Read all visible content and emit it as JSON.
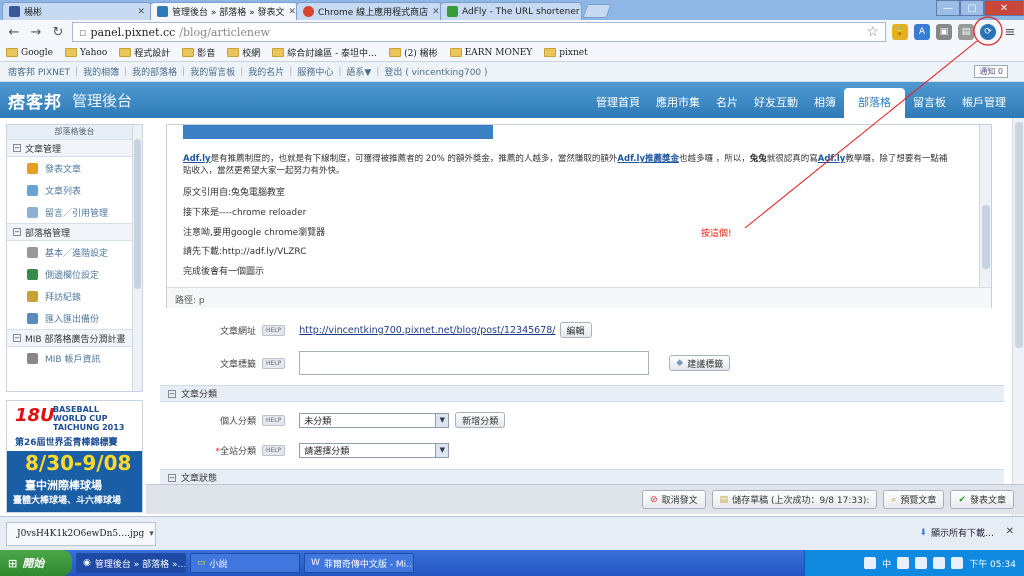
{
  "tabs": [
    {
      "label": "楊彬",
      "color": "#3b5998"
    },
    {
      "label": "管理後台 » 部落格 » 發表文",
      "color": "#2f7bb8"
    },
    {
      "label": "Chrome 線上應用程式商店",
      "color": "#d9442e"
    },
    {
      "label": "AdFly - The URL shortener",
      "color": "#3a9a3a"
    }
  ],
  "window_buttons": {
    "minimize": "—",
    "maximize": "▢",
    "close": "✕"
  },
  "toolbar": {
    "host": "panel.pixnet.cc",
    "path": "/blog/articlenew"
  },
  "bookmarks": [
    "Google",
    "Yahoo",
    "程式設計",
    "影音",
    "校網",
    "綜合討論區 - 泰坦中…",
    "(2) 楊彬",
    "EARN MONEY",
    "pixnet"
  ],
  "pixbar": {
    "links": [
      "痞客邦 PIXNET",
      "我的相簿",
      "我的部落格",
      "我的留言板",
      "我的名片",
      "服務中心",
      "語系▼",
      "登出 ( vincentking700 )"
    ],
    "notify": "通知 0"
  },
  "header": {
    "logo": "痞客邦",
    "title": "管理後台",
    "nav": [
      "管理首頁",
      "應用市集",
      "名片",
      "好友互動",
      "相簿",
      "部落格",
      "留言板",
      "帳戶管理"
    ],
    "active_nav": "部落格"
  },
  "sidebar": {
    "title": "部落格後台",
    "sections": [
      {
        "label": "文章管理",
        "items": [
          "發表文章",
          "文章列表",
          "留言／引用管理"
        ]
      },
      {
        "label": "部落格管理",
        "items": [
          "基本／進階設定",
          "側邊欄位設定",
          "拜訪紀錄",
          "匯入匯出備份"
        ]
      },
      {
        "label": "MIB 部落格廣告分潤計畫",
        "items": [
          "MIB 帳戶資訊"
        ]
      }
    ]
  },
  "ad": {
    "brand": "18U",
    "cup": [
      "BASEBALL",
      "WORLD CUP",
      "TAICHUNG 2013"
    ],
    "title": "第26屆世界盃青棒錦標賽",
    "dates": "8/30-9/08",
    "venue": "臺中洲際棒球場",
    "venue2": "臺體大棒球場、斗六棒球場"
  },
  "editor": {
    "para_link1": "Adf.ly",
    "para_text1": "是有推薦制度的，也就是有下線制度，可獲得被推薦者的 20% 的額外獎金，推薦的人越多，當然賺取的額外",
    "para_link2": "Adf.ly推薦獎金",
    "para_text2": "也越多囉 ，所以，",
    "para_bold": "兔兔",
    "para_text3": "就很認真的寫",
    "para_link3": "Adf.ly",
    "para_text4": "教學囉，除了想要有一點補貼收入，當然更希望大家一起努力有外快。",
    "lines": [
      "原文引用自:兔兔電腦教室",
      "接下來是----chrome reloader",
      "注意呦,要用google chrome瀏覽器",
      "請先下載:http://adf.ly/VLZRC",
      "完成後會有一個圖示"
    ],
    "path_label": "路徑: p"
  },
  "annotation": "按這個!",
  "form": {
    "url_label": "文章網址",
    "url": "http://vincentking700.pixnet.net/blog/post/12345678/",
    "edit_button": "編輯",
    "tag_label": "文章標籤",
    "tag_value": "",
    "suggest_button": "建議標籤",
    "category_section": "文章分類",
    "personal_label": "個人分類",
    "personal_value": "未分類",
    "new_category_button": "新增分類",
    "site_label": "全站分類",
    "site_value": "請選擇分類",
    "status_section": "文章狀態",
    "help": "HELP"
  },
  "actions": {
    "cancel": "取消發文",
    "draft": "儲存草稿 (上次成功：9/8 17:33):",
    "preview": "預覽文章",
    "publish": "發表文章"
  },
  "downloads": {
    "file": "J0vsH4K1k2O6ewDn5….jpg",
    "show_all": "顯示所有下載…"
  },
  "taskbar": {
    "start": "開始",
    "tasks": [
      "管理後台 » 部落格 »…",
      "小說",
      "菲爾奇傳中文版 - Mi…"
    ],
    "tray_lang": "中",
    "clock": "下午 05:34"
  },
  "colors": {
    "accent": "#2f7bb8",
    "annotation": "#e21f1f"
  }
}
